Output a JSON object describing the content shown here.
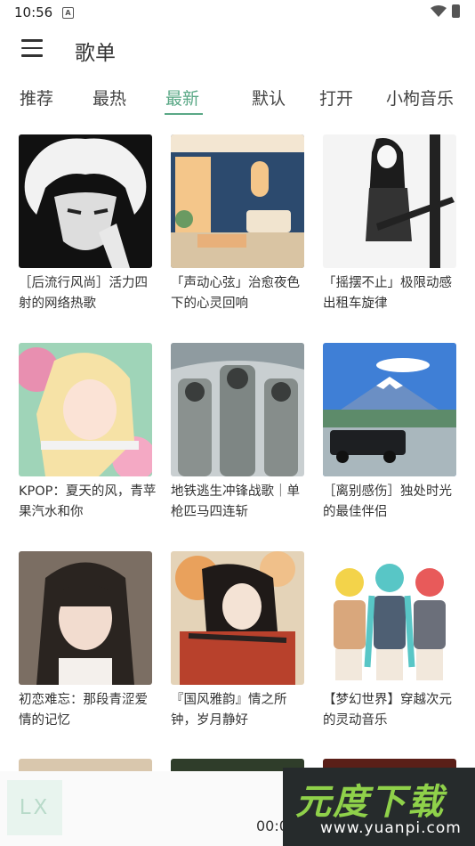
{
  "status_bar": {
    "time": "10:56",
    "notification_badge": "A"
  },
  "app_bar": {
    "title": "歌单"
  },
  "tabs": [
    {
      "label": "推荐",
      "active": false
    },
    {
      "label": "最热",
      "active": false
    },
    {
      "label": "最新",
      "active": true
    },
    {
      "label": "默认",
      "active": false
    },
    {
      "label": "打开",
      "active": false
    },
    {
      "label": "小枸音乐",
      "active": false
    }
  ],
  "playlists": [
    {
      "title": "［后流行风尚］活力四射的网络热歌"
    },
    {
      "title": "「声动心弦」治愈夜色下的心灵回响"
    },
    {
      "title": "「摇摆不止」极限动感出租车旋律"
    },
    {
      "title": "KPOP：夏天的风，青苹果汽水和你"
    },
    {
      "title": "地铁逃生冲锋战歌｜单枪匹马四连斩"
    },
    {
      "title": "［离别感伤］独处时光的最佳伴侣"
    },
    {
      "title": "初恋难忘：那段青涩爱情的记忆"
    },
    {
      "title": "『国风雅韵』情之所钟，岁月静好"
    },
    {
      "title": "【梦幻世界】穿越次元的灵动音乐"
    }
  ],
  "player": {
    "logo_text": "LX",
    "time": "00:00"
  },
  "watermark": {
    "brand": "元度下载",
    "url": "www.yuanpi.com"
  },
  "colors": {
    "accent": "#5aa886",
    "text": "#333333"
  }
}
